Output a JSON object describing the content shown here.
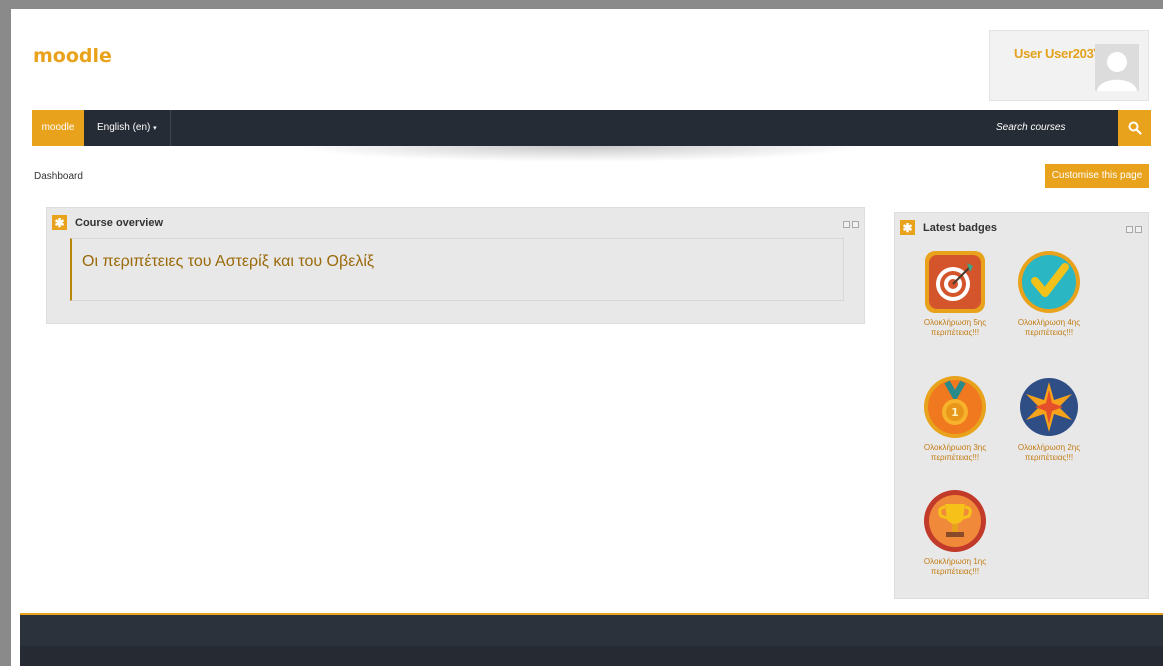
{
  "header": {
    "logo": "moodle",
    "user_name": "User User203"
  },
  "navbar": {
    "brand": "moodle",
    "language": "English (en)",
    "search_placeholder": "Search courses"
  },
  "breadcrumb": {
    "item": "Dashboard"
  },
  "actions": {
    "customise_label": "Customise this page"
  },
  "course_overview": {
    "title": "Course overview",
    "courses": [
      "Οι περιπέτειες του Αστερίξ και του Οβελίξ"
    ]
  },
  "latest_badges": {
    "title": "Latest badges",
    "badges": [
      {
        "line1": "Ολοκλήρωση 5ης",
        "line2": "περιπέτειας!!!",
        "icon": "target-icon"
      },
      {
        "line1": "Ολοκλήρωση 4ης",
        "line2": "περιπέτειας!!!",
        "icon": "checkmark-icon"
      },
      {
        "line1": "Ολοκλήρωση 3ης",
        "line2": "περιπέτειας!!!",
        "icon": "medal-icon"
      },
      {
        "line1": "Ολοκλήρωση 2ης",
        "line2": "περιπέτειας!!!",
        "icon": "star-icon"
      },
      {
        "line1": "Ολοκλήρωση 1ης",
        "line2": "περιπέτειας!!!",
        "icon": "trophy-icon"
      }
    ]
  },
  "colors": {
    "accent": "#e8a21b",
    "navbar": "#262c36",
    "block_bg": "#e8e8e8"
  }
}
